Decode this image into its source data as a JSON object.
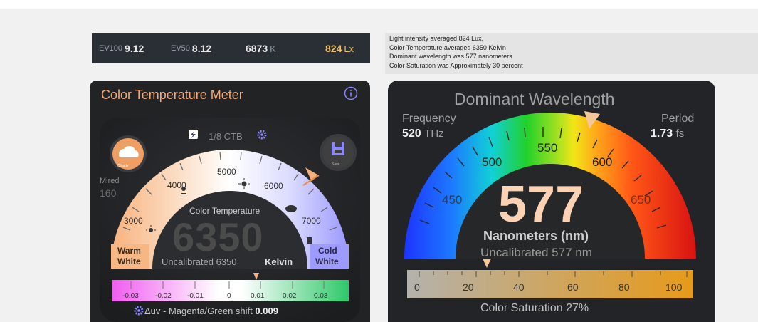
{
  "ev_bar": {
    "ev100_label": "EV100",
    "ev100_value": "9.12",
    "ev50_label": "EV50",
    "ev50_value": "8.12",
    "kelvin_value": "6873",
    "kelvin_unit": "K",
    "lux_value": "824",
    "lux_unit": "Lx"
  },
  "summary": {
    "line1": "Light intensity averaged 824 Lux,",
    "line2": "Color Temperature averaged 6350 Kelvin",
    "line3": "Dominant wavelength was 577 nanometers",
    "line4": "Color Saturation was Approximately 30 percent"
  },
  "color_temp_meter": {
    "title": "Color Temperature Meter",
    "filter_label": "1/8 CTB",
    "cloudy_label": "Cloudy",
    "save_label": "Save",
    "mired_label": "Mired",
    "mired_value": "160",
    "gauge_label": "Color Temperature",
    "reading": "6350",
    "uncalibrated": "Uncalibrated 6350",
    "unit": "Kelvin",
    "warm_line1": "Warm",
    "warm_line2": "White",
    "cold_line1": "Cold",
    "cold_line2": "White",
    "ticks": [
      "3000",
      "4000",
      "5000",
      "6000",
      "7000"
    ],
    "duv_ticks": [
      "-0.03",
      "-0.02",
      "-0.01",
      "0",
      "0.01",
      "0.02",
      "0.03"
    ],
    "duv_caption": "Δuv - Magenta/Green shift",
    "duv_value": "0.009",
    "colors": {
      "accent": "#f2a877",
      "warm": "#f7b784",
      "cold": "#9e9bff",
      "panel": "#222325"
    }
  },
  "dominant_wavelength": {
    "title": "Dominant Wavelength",
    "frequency_label": "Frequency",
    "frequency_value": "520",
    "frequency_unit": "THz",
    "period_label": "Period",
    "period_value": "1.73",
    "period_unit": "fs",
    "scale_ticks": [
      "450",
      "500",
      "550",
      "600",
      "650"
    ],
    "reading": "577",
    "unit_label": "Nanometers (nm)",
    "uncalibrated": "Uncalibrated 577 nm",
    "saturation_ticks": [
      "0",
      "20",
      "40",
      "60",
      "80",
      "100"
    ],
    "saturation_caption": "Color Saturation 27%",
    "saturation_percent": 27,
    "colors": {
      "reading": "#fbd3b4"
    }
  }
}
